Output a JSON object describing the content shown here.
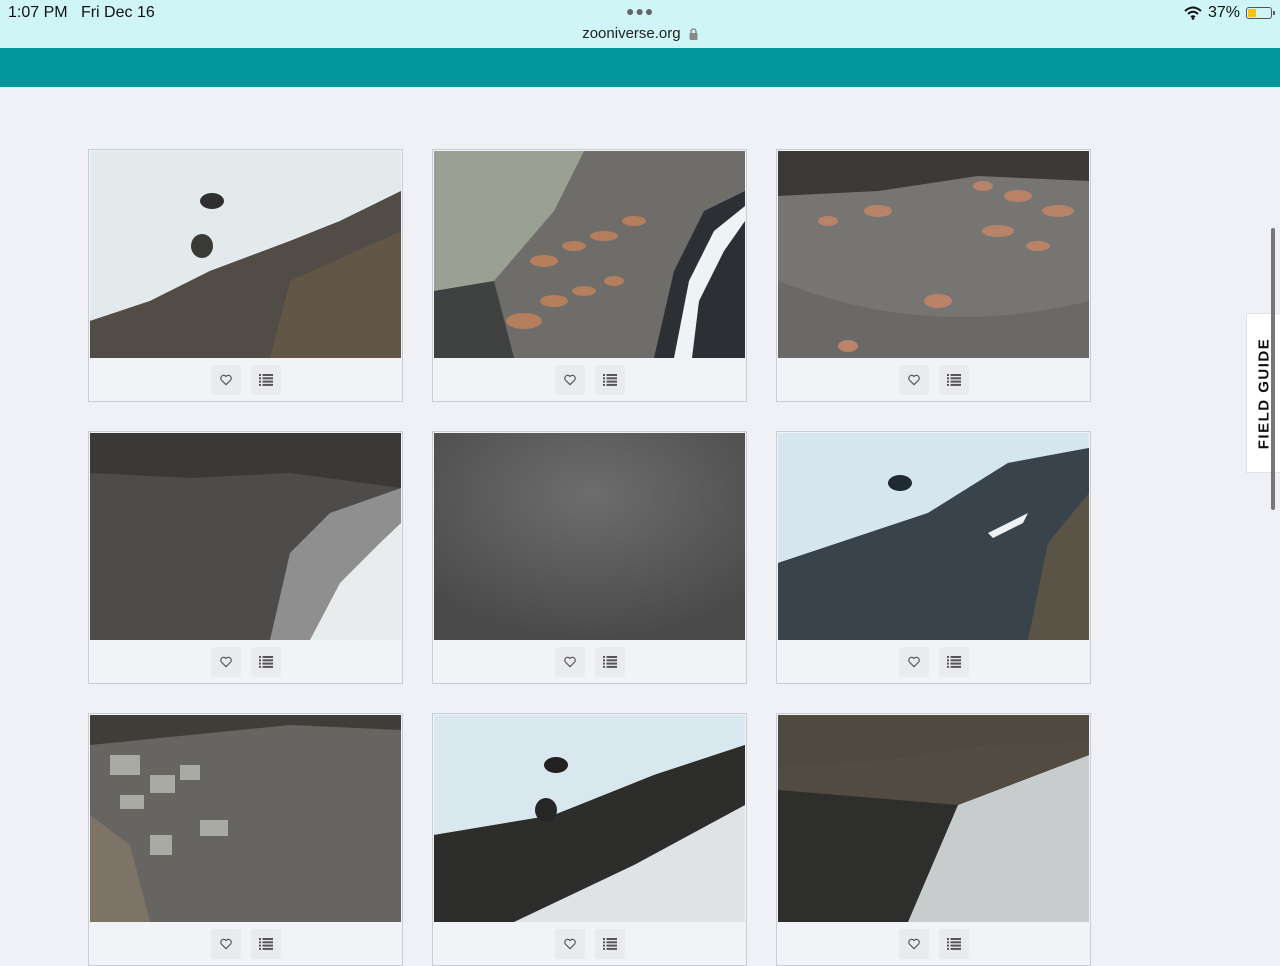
{
  "status_bar": {
    "time": "1:07 PM",
    "date": "Fri Dec 16",
    "url": "zooniverse.org",
    "battery_percent": "37%",
    "battery_level": 0.37
  },
  "side_tab": {
    "label": "FIELD GUIDE"
  },
  "colors": {
    "header": "#00979d",
    "status_bg": "#cff5f7",
    "page_bg": "#eff1f6"
  },
  "subjects": [
    {
      "scene": "snowy rocky slope with boulders"
    },
    {
      "scene": "sea lions on beach beside surf"
    },
    {
      "scene": "sea lions scattered on grey beach"
    },
    {
      "scene": "dark beach with foam, misty"
    },
    {
      "scene": "fogged grey frame"
    },
    {
      "scene": "blue-tinted shore with snow"
    },
    {
      "scene": "rocky cove with boulders"
    },
    {
      "scene": "surf and snowy rocks"
    },
    {
      "scene": "dark beach with pale sand"
    }
  ]
}
